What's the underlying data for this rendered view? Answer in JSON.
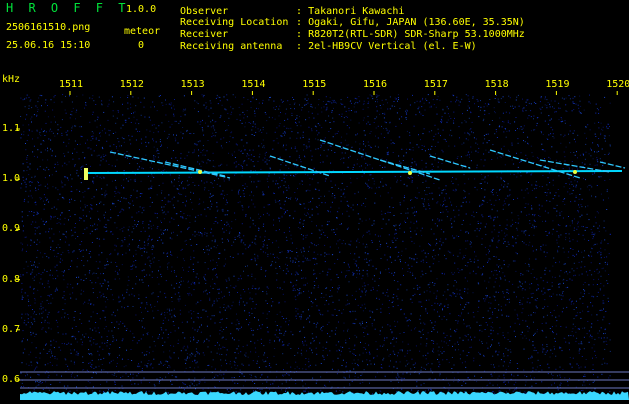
{
  "header": {
    "app_title": "H R O F F T",
    "app_version": "1.0.0",
    "file_name": "2506161510.png",
    "meteor_label": "meteor",
    "timestamp": "25.06.16 15:10",
    "meteor_count": "0",
    "info": [
      {
        "key": "Observer",
        "sep": ":",
        "value": "Takanori Kawachi"
      },
      {
        "key": "Receiving Location",
        "sep": ":",
        "value": "Ogaki, Gifu, JAPAN (136.60E, 35.35N)"
      },
      {
        "key": "Receiver",
        "sep": ":",
        "value": "R820T2(RTL-SDR) SDR-Sharp 53.1000MHz"
      },
      {
        "key": "Receiving antenna",
        "sep": ":",
        "value": "2el-HB9CV Vertical (el. E-W)"
      }
    ]
  },
  "spectrogram": {
    "unit_label": "kHz",
    "x_ticks": [
      "1511",
      "1512",
      "1513",
      "1514",
      "1515",
      "1516",
      "1517",
      "1518",
      "1519",
      "1520"
    ],
    "y_ticks": [
      "1.1",
      "1.0",
      "0.9",
      "0.8",
      "0.7",
      "0.6"
    ],
    "colors": {
      "background": "#000000",
      "noise": "#0a1a7a",
      "signal": "#00d8ff",
      "text": "#ffff00",
      "title": "#00e23a"
    }
  }
}
